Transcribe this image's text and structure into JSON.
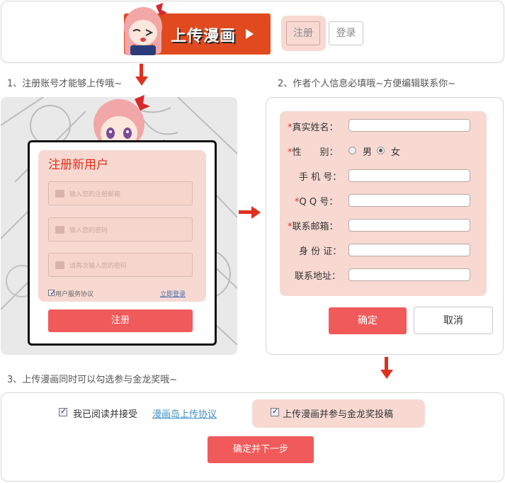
{
  "header": {
    "upload_title": "上传漫画",
    "register_label": "注册",
    "login_label": "登录"
  },
  "steps": {
    "step1": "1、注册账号才能够上传哦~",
    "step2": "2、作者个人信息必填哦~方便编辑联系你~",
    "step3": "3、上传漫画同时可以勾选参与金龙奖哦~"
  },
  "register_form": {
    "title": "注册新用户",
    "email_placeholder": "输入您的注册邮箱",
    "password_placeholder": "输入您的密码",
    "confirm_placeholder": "请再次输入您的密码",
    "terms_label": "用户服务协议",
    "login_link": "立即登录",
    "submit_label": "注册"
  },
  "info_form": {
    "required_mark": "*",
    "name_label": "真实姓名：",
    "gender_label": "性　　别：",
    "male": "男",
    "female": "女",
    "selected_gender": "女",
    "phone_label": "手 机 号：",
    "qq_label": "Q Q 号：",
    "email_label": "联系邮箱：",
    "id_label": "身 份 证：",
    "address_label": "联系地址：",
    "confirm_label": "确定",
    "cancel_label": "取消"
  },
  "agreement": {
    "read_label": "我已阅读并接受",
    "agreement_link": "漫画岛上传协议",
    "award_label": "上传漫画并参与金龙奖投稿",
    "next_label": "确定并下一步"
  },
  "colors": {
    "accent": "#e0301e",
    "button": "#f15a5a",
    "pink_bg": "#f7d9d2"
  }
}
